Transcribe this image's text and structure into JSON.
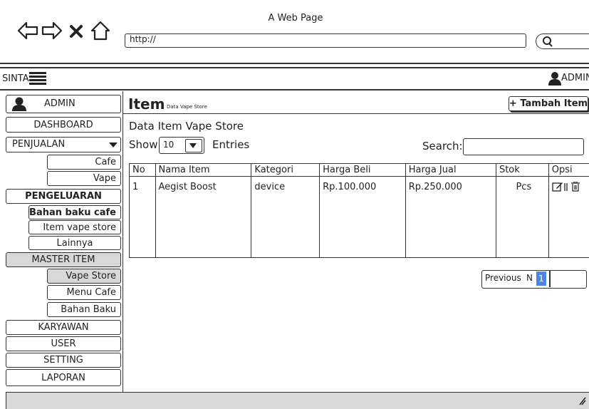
{
  "browser": {
    "title": "A Web Page",
    "url": "http://"
  },
  "topbar": {
    "brand": "SINTA",
    "user": "ADMIN"
  },
  "sidebar": {
    "user": "ADMIN",
    "items": [
      {
        "label": "DASHBOARD"
      },
      {
        "label": "PENJUALAN"
      },
      {
        "label": "Cafe"
      },
      {
        "label": "Vape"
      },
      {
        "label": "PENGELUARAN"
      },
      {
        "label": "Bahan baku cafe"
      },
      {
        "label": "Item vape store"
      },
      {
        "label": "Lainnya"
      },
      {
        "label": "MASTER ITEM"
      },
      {
        "label": "Vape Store"
      },
      {
        "label": "Menu Cafe"
      },
      {
        "label": "Bahan Baku"
      },
      {
        "label": "KARYAWAN"
      },
      {
        "label": "USER"
      },
      {
        "label": "SETTING"
      },
      {
        "label": "LAPORAN"
      }
    ]
  },
  "main": {
    "title": "Item",
    "subtitle": "Data Vape Store",
    "add_button": "+ Tambah Item",
    "heading": "Data Item Vape Store",
    "show_label": "Show",
    "entries_value": "10",
    "entries_label": "Entries",
    "search_label": "Search:",
    "table": {
      "headers": [
        "No",
        "Nama Item",
        "Kategori",
        "Harga Beli",
        "Harga Jual",
        "Stok",
        "Opsi"
      ],
      "rows": [
        [
          "1",
          "Aegist Boost",
          "device",
          "Rp.100.000",
          "Rp.250.000",
          "Pcs"
        ]
      ]
    },
    "pagination": {
      "previous": "Previous",
      "next": "N",
      "current": "1"
    }
  },
  "colors": {
    "selected_item": "#d8d8d8",
    "page_active": "#4a86e8"
  }
}
